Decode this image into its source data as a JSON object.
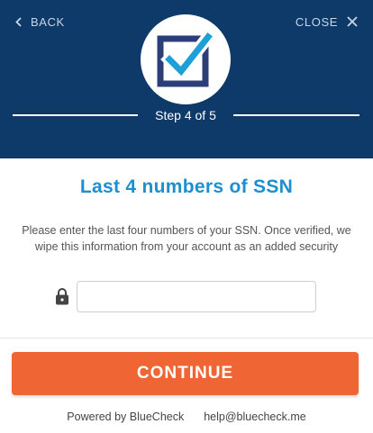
{
  "header": {
    "back_label": "BACK",
    "close_label": "CLOSE",
    "step_text": "Step 4 of 5",
    "background_color": "#0d3a68",
    "logo_icon": "checkbox-check-icon"
  },
  "main": {
    "title": "Last 4 numbers of SSN",
    "description": "Please enter the last four numbers of your SSN. Once verified, we wipe this information from your account as an added security",
    "lock_icon": "lock-icon",
    "ssn_input": {
      "value": "",
      "placeholder": ""
    },
    "title_color": "#1d8fd0"
  },
  "actions": {
    "continue_label": "CONTINUE",
    "continue_color": "#ef6533"
  },
  "footer": {
    "powered_by": "Powered by BlueCheck",
    "help_email": "help@bluecheck.me"
  }
}
